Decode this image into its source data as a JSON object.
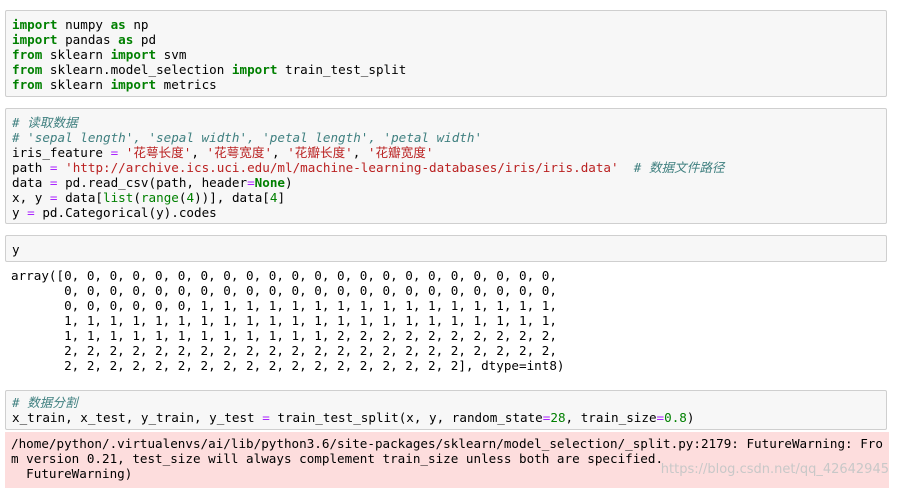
{
  "cells": [
    {
      "lines": [
        [
          {
            "t": "import",
            "c": "kw"
          },
          {
            "t": " numpy "
          },
          {
            "t": "as",
            "c": "kw"
          },
          {
            "t": " np"
          }
        ],
        [
          {
            "t": "import",
            "c": "kw"
          },
          {
            "t": " pandas "
          },
          {
            "t": "as",
            "c": "kw"
          },
          {
            "t": " pd"
          }
        ],
        [
          {
            "t": "from",
            "c": "kw"
          },
          {
            "t": " sklearn "
          },
          {
            "t": "import",
            "c": "kw"
          },
          {
            "t": " svm"
          }
        ],
        [
          {
            "t": "from",
            "c": "kw"
          },
          {
            "t": " sklearn.model_selection "
          },
          {
            "t": "import",
            "c": "kw"
          },
          {
            "t": " train_test_split"
          }
        ],
        [
          {
            "t": "from",
            "c": "kw"
          },
          {
            "t": " sklearn "
          },
          {
            "t": "import",
            "c": "kw"
          },
          {
            "t": " metrics"
          }
        ]
      ]
    },
    {
      "lines": [
        [
          {
            "t": "# 读取数据",
            "c": "cm"
          }
        ],
        [
          {
            "t": "# 'sepal length', 'sepal width', 'petal length', 'petal width'",
            "c": "cm"
          }
        ],
        [
          {
            "t": "iris_feature "
          },
          {
            "t": "=",
            "c": "op"
          },
          {
            "t": " "
          },
          {
            "t": "'花萼长度'",
            "c": "st"
          },
          {
            "t": ", "
          },
          {
            "t": "'花萼宽度'",
            "c": "st"
          },
          {
            "t": ", "
          },
          {
            "t": "'花瓣长度'",
            "c": "st"
          },
          {
            "t": ", "
          },
          {
            "t": "'花瓣宽度'",
            "c": "st"
          }
        ],
        [
          {
            "t": "path "
          },
          {
            "t": "=",
            "c": "op"
          },
          {
            "t": " "
          },
          {
            "t": "'http://archive.ics.uci.edu/ml/machine-learning-databases/iris/iris.data'",
            "c": "st"
          },
          {
            "t": "  "
          },
          {
            "t": "# 数据文件路径",
            "c": "cm"
          }
        ],
        [
          {
            "t": "data "
          },
          {
            "t": "=",
            "c": "op"
          },
          {
            "t": " pd.read_csv(path, header"
          },
          {
            "t": "=",
            "c": "op"
          },
          {
            "t": "None",
            "c": "kw"
          },
          {
            "t": ")"
          }
        ],
        [
          {
            "t": "x, y "
          },
          {
            "t": "=",
            "c": "op"
          },
          {
            "t": " data["
          },
          {
            "t": "list",
            "c": "bi"
          },
          {
            "t": "("
          },
          {
            "t": "range",
            "c": "bi"
          },
          {
            "t": "("
          },
          {
            "t": "4",
            "c": "nu"
          },
          {
            "t": "))], data["
          },
          {
            "t": "4",
            "c": "nu"
          },
          {
            "t": "]"
          }
        ],
        [
          {
            "t": "y "
          },
          {
            "t": "=",
            "c": "op"
          },
          {
            "t": " pd.Categorical(y).codes"
          }
        ]
      ]
    },
    {
      "lines": [
        [
          {
            "t": "y"
          }
        ]
      ]
    },
    {
      "lines": [
        [
          {
            "t": "# 数据分割",
            "c": "cm"
          }
        ],
        [
          {
            "t": "x_train, x_test, y_train, y_test "
          },
          {
            "t": "=",
            "c": "op"
          },
          {
            "t": " train_test_split(x, y, random_state"
          },
          {
            "t": "=",
            "c": "op"
          },
          {
            "t": "28",
            "c": "nu"
          },
          {
            "t": ", train_size"
          },
          {
            "t": "=",
            "c": "op"
          },
          {
            "t": "0.8",
            "c": "nu"
          },
          {
            "t": ")"
          }
        ]
      ]
    }
  ],
  "output_y": [
    "array([0, 0, 0, 0, 0, 0, 0, 0, 0, 0, 0, 0, 0, 0, 0, 0, 0, 0, 0, 0, 0, 0,",
    "       0, 0, 0, 0, 0, 0, 0, 0, 0, 0, 0, 0, 0, 0, 0, 0, 0, 0, 0, 0, 0, 0,",
    "       0, 0, 0, 0, 0, 0, 1, 1, 1, 1, 1, 1, 1, 1, 1, 1, 1, 1, 1, 1, 1, 1,",
    "       1, 1, 1, 1, 1, 1, 1, 1, 1, 1, 1, 1, 1, 1, 1, 1, 1, 1, 1, 1, 1, 1,",
    "       1, 1, 1, 1, 1, 1, 1, 1, 1, 1, 1, 1, 2, 2, 2, 2, 2, 2, 2, 2, 2, 2,",
    "       2, 2, 2, 2, 2, 2, 2, 2, 2, 2, 2, 2, 2, 2, 2, 2, 2, 2, 2, 2, 2, 2,",
    "       2, 2, 2, 2, 2, 2, 2, 2, 2, 2, 2, 2, 2, 2, 2, 2, 2, 2], dtype=int8)"
  ],
  "warning": [
    "/home/python/.virtualenvs/ai/lib/python3.6/site-packages/sklearn/model_selection/_split.py:2179: FutureWarning: Fro",
    "m version 0.21, test_size will always complement train_size unless both are specified.",
    "  FutureWarning)"
  ],
  "watermark": "https://blog.csdn.net/qq_42642945"
}
